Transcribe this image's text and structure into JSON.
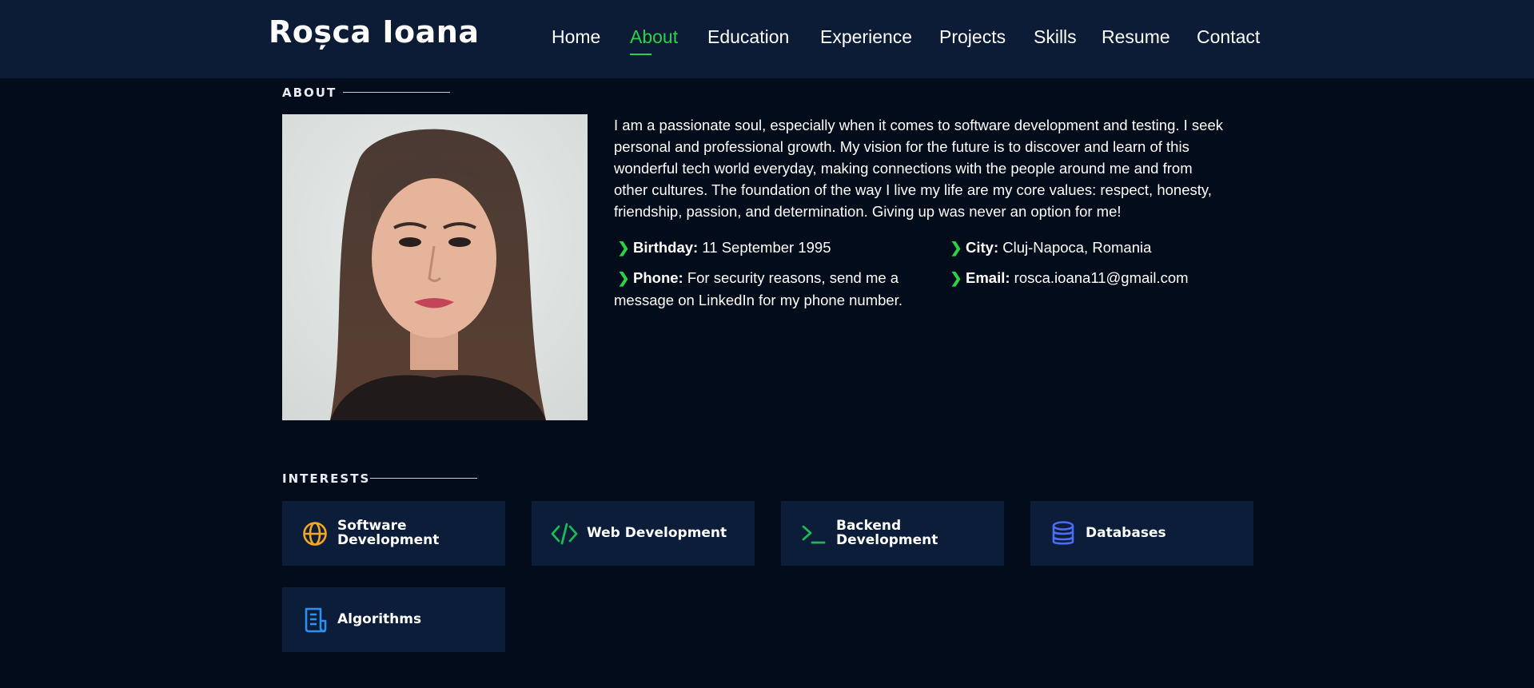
{
  "header": {
    "logo": "Roșca Ioana",
    "nav": [
      {
        "label": "Home"
      },
      {
        "label": "About"
      },
      {
        "label": "Education"
      },
      {
        "label": "Experience"
      },
      {
        "label": "Projects"
      },
      {
        "label": "Skills"
      },
      {
        "label": "Resume"
      },
      {
        "label": "Contact"
      }
    ],
    "active_nav": "About"
  },
  "about": {
    "title": "ABOUT",
    "bio_lines": [
      "I am a passionate soul, especially when it comes to software development and testing. I seek",
      "personal and professional growth. My vision for the future is to discover and learn of this",
      "wonderful tech world everyday, making connections with the people around me and from",
      "other cultures. The foundation of the way I live my life are my core values: respect, honesty,",
      "friendship, passion, and determination. Giving up was never an option for me!"
    ],
    "info": {
      "birthday": {
        "label": "Birthday:",
        "value": "11 September 1995"
      },
      "city": {
        "label": "City:",
        "value": "Cluj-Napoca, Romania"
      },
      "phone": {
        "label": "Phone:",
        "value_line1": "For security reasons, send me a",
        "value_line2": "message on LinkedIn for my phone number."
      },
      "email": {
        "label": "Email:",
        "value": "rosca.ioana11@gmail.com"
      }
    }
  },
  "interests": {
    "title": "INTERESTS",
    "items": [
      {
        "label_line1": "Software",
        "label_line2": "Development",
        "icon": "globe-icon",
        "color": "#f5a623"
      },
      {
        "label_line1": "Web Development",
        "label_line2": "",
        "icon": "code-icon",
        "color": "#1db954"
      },
      {
        "label_line1": "Backend",
        "label_line2": "Development",
        "icon": "terminal-icon",
        "color": "#1db954"
      },
      {
        "label_line1": "Databases",
        "label_line2": "",
        "icon": "database-icon",
        "color": "#4a6cf7"
      },
      {
        "label_line1": "Algorithms",
        "label_line2": "",
        "icon": "document-icon",
        "color": "#2f8ff0"
      }
    ]
  },
  "colors": {
    "accent": "#2ad14a",
    "header_bg": "#0c1c36",
    "page_bg": "#030c1a",
    "card_bg": "#0b1d38"
  }
}
